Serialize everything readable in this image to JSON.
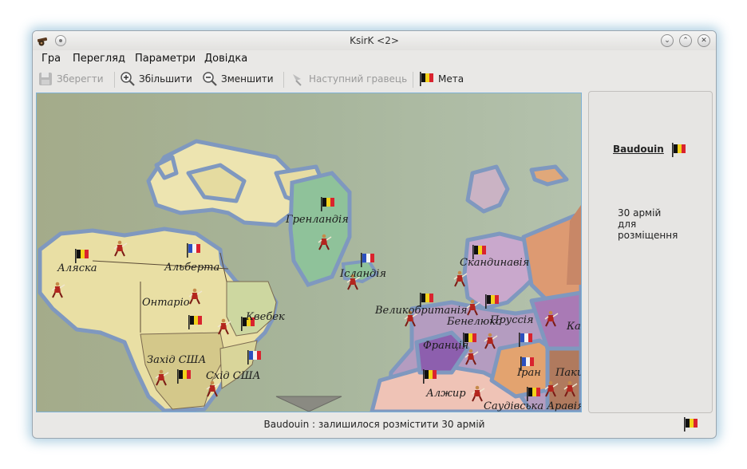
{
  "window": {
    "title": "KsirK <2>"
  },
  "menu": [
    "Гра",
    "Перегляд",
    "Параметри",
    "Довідка"
  ],
  "toolbar": {
    "save": "Зберегти",
    "zoom_in": "Збільшити",
    "zoom_out": "Зменшити",
    "next_player": "Наступний гравець",
    "goal": "Мета"
  },
  "map": {
    "labels": {
      "alaska": "Аляска",
      "alberta": "Альберта",
      "ontario": "Онтаріо",
      "quebec": "Квебек",
      "west_usa": "Захід США",
      "east_usa": "Схід США",
      "greenland": "Гренландія",
      "iceland": "Ісландія",
      "scandinavia": "Скандинавія",
      "great_britain": "Великобританія",
      "benelux": "Бенелюкс",
      "prussia": "Пруссія",
      "france": "Франція",
      "iran": "Іран",
      "algeria": "Алжир",
      "saudi_arabia": "Саудівська Аравія",
      "pakistan": "Пакистан",
      "kazakhstan": "Казахстан"
    }
  },
  "side_panel": {
    "player": "Baudouin",
    "armies_line1": "30 армій",
    "armies_line2": "для",
    "armies_line3": "розміщення"
  },
  "status": {
    "message": "Baudouin : залишилося розмістити 30 армій"
  },
  "colors": {
    "accent": "#7fb2d6",
    "belgium_black": "#111111",
    "belgium_yellow": "#f2d21b",
    "belgium_red": "#d9232e"
  }
}
